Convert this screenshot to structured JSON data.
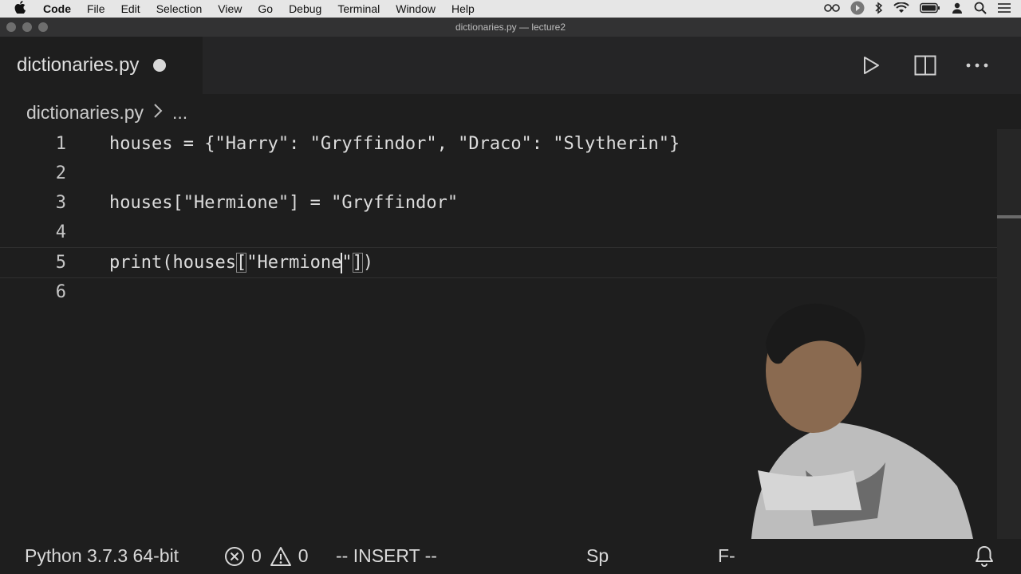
{
  "menubar": {
    "apple": "",
    "items": [
      "Code",
      "File",
      "Edit",
      "Selection",
      "View",
      "Go",
      "Debug",
      "Terminal",
      "Window",
      "Help"
    ],
    "tray_icons": [
      "glasses-icon",
      "record-icon",
      "bluetooth-icon",
      "wifi-icon",
      "battery-icon",
      "user-icon",
      "search-icon",
      "list-icon"
    ]
  },
  "titlebar": {
    "title": "dictionaries.py — lecture2"
  },
  "tab": {
    "label": "dictionaries.py",
    "dirty": true
  },
  "breadcrumb": {
    "file": "dictionaries.py",
    "more": "..."
  },
  "editor": {
    "lines": [
      {
        "number": "1",
        "text": "houses = {\"Harry\": \"Gryffindor\", \"Draco\": \"Slytherin\"}"
      },
      {
        "number": "2",
        "text": ""
      },
      {
        "number": "3",
        "text": "houses[\"Hermione\"] = \"Gryffindor\""
      },
      {
        "number": "4",
        "text": ""
      },
      {
        "number": "5",
        "pre": "print(houses",
        "b_open": "[",
        "str_text": "\"Hermione",
        "str_close": "\"",
        "b_close": "]",
        "post": ")"
      },
      {
        "number": "6",
        "text": ""
      }
    ],
    "current_line": 5
  },
  "statusbar": {
    "interpreter": "Python 3.7.3 64-bit",
    "errors": "0",
    "warnings": "0",
    "mode": "-- INSERT --",
    "partial_left": "Sp",
    "partial_right": "F-"
  },
  "colors": {
    "editor_bg": "#1e1e1e",
    "tabbar_bg": "#252526",
    "menubar_bg": "#e6e6e6",
    "text": "#dcdcdc"
  }
}
